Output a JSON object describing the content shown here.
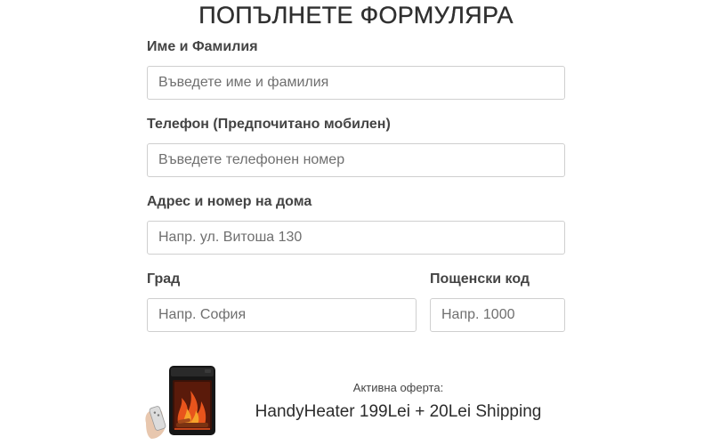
{
  "form": {
    "title": "ПОПЪЛНЕТЕ ФОРМУЛЯРА",
    "fields": {
      "name": {
        "label": "Име и Фамилия",
        "placeholder": "Въведете име и фамилия",
        "value": ""
      },
      "phone": {
        "label": "Телефон (Предпочитано мобилен)",
        "placeholder": "Въведете телефонен номер",
        "value": ""
      },
      "address": {
        "label": "Адрес и номер на дома",
        "placeholder": "Напр. ул. Витоша 130",
        "value": ""
      },
      "city": {
        "label": "Град",
        "placeholder": "Напр. София",
        "value": ""
      },
      "postcode": {
        "label": "Пощенски код",
        "placeholder": "Напр. 1000",
        "value": ""
      }
    }
  },
  "offer": {
    "kicker": "Активна оферта:",
    "headline": "HandyHeater 199Lei + 20Lei Shipping",
    "image_icon": "portable-heater-product-image"
  },
  "colors": {
    "input_border": "#cfcfcf",
    "label_text": "#444444",
    "heater_body": "#1a1a1a",
    "flame": "#e8541c"
  }
}
